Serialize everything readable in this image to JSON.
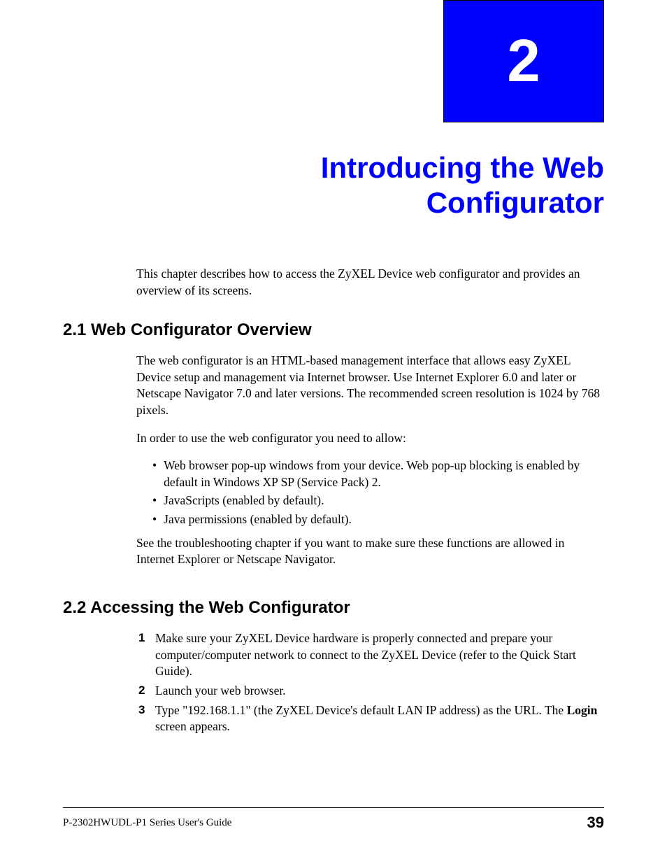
{
  "chapter": {
    "number": "2",
    "title": "Introducing the Web Configurator",
    "intro": "This chapter describes how to access the ZyXEL Device web configurator and provides an overview of its screens."
  },
  "section21": {
    "heading": "2.1  Web Configurator Overview",
    "p1": "The web configurator is an HTML-based management interface that allows easy ZyXEL Device setup and management via Internet browser. Use Internet Explorer 6.0 and later or Netscape Navigator 7.0 and later versions. The recommended screen resolution is 1024 by 768 pixels.",
    "p2": "In order to use the web configurator you need to allow:",
    "bullets": [
      "Web browser pop-up windows from your device. Web pop-up blocking is enabled by default in Windows XP SP (Service Pack) 2.",
      "JavaScripts (enabled by default).",
      "Java permissions (enabled by default)."
    ],
    "p3": "See the troubleshooting chapter if you want to make sure these functions are allowed in Internet Explorer or Netscape Navigator."
  },
  "section22": {
    "heading": "2.2  Accessing the Web Configurator",
    "steps": [
      "Make sure your ZyXEL Device hardware is properly connected and prepare your computer/computer network to connect to the ZyXEL Device (refer to the Quick Start Guide).",
      "Launch your web browser.",
      "Type \"192.168.1.1\" (the ZyXEL Device's default LAN IP address) as the URL. The "
    ],
    "step3_bold": "Login",
    "step3_tail": " screen appears."
  },
  "footer": {
    "guide": "P-2302HWUDL-P1 Series User's Guide",
    "page": "39"
  }
}
